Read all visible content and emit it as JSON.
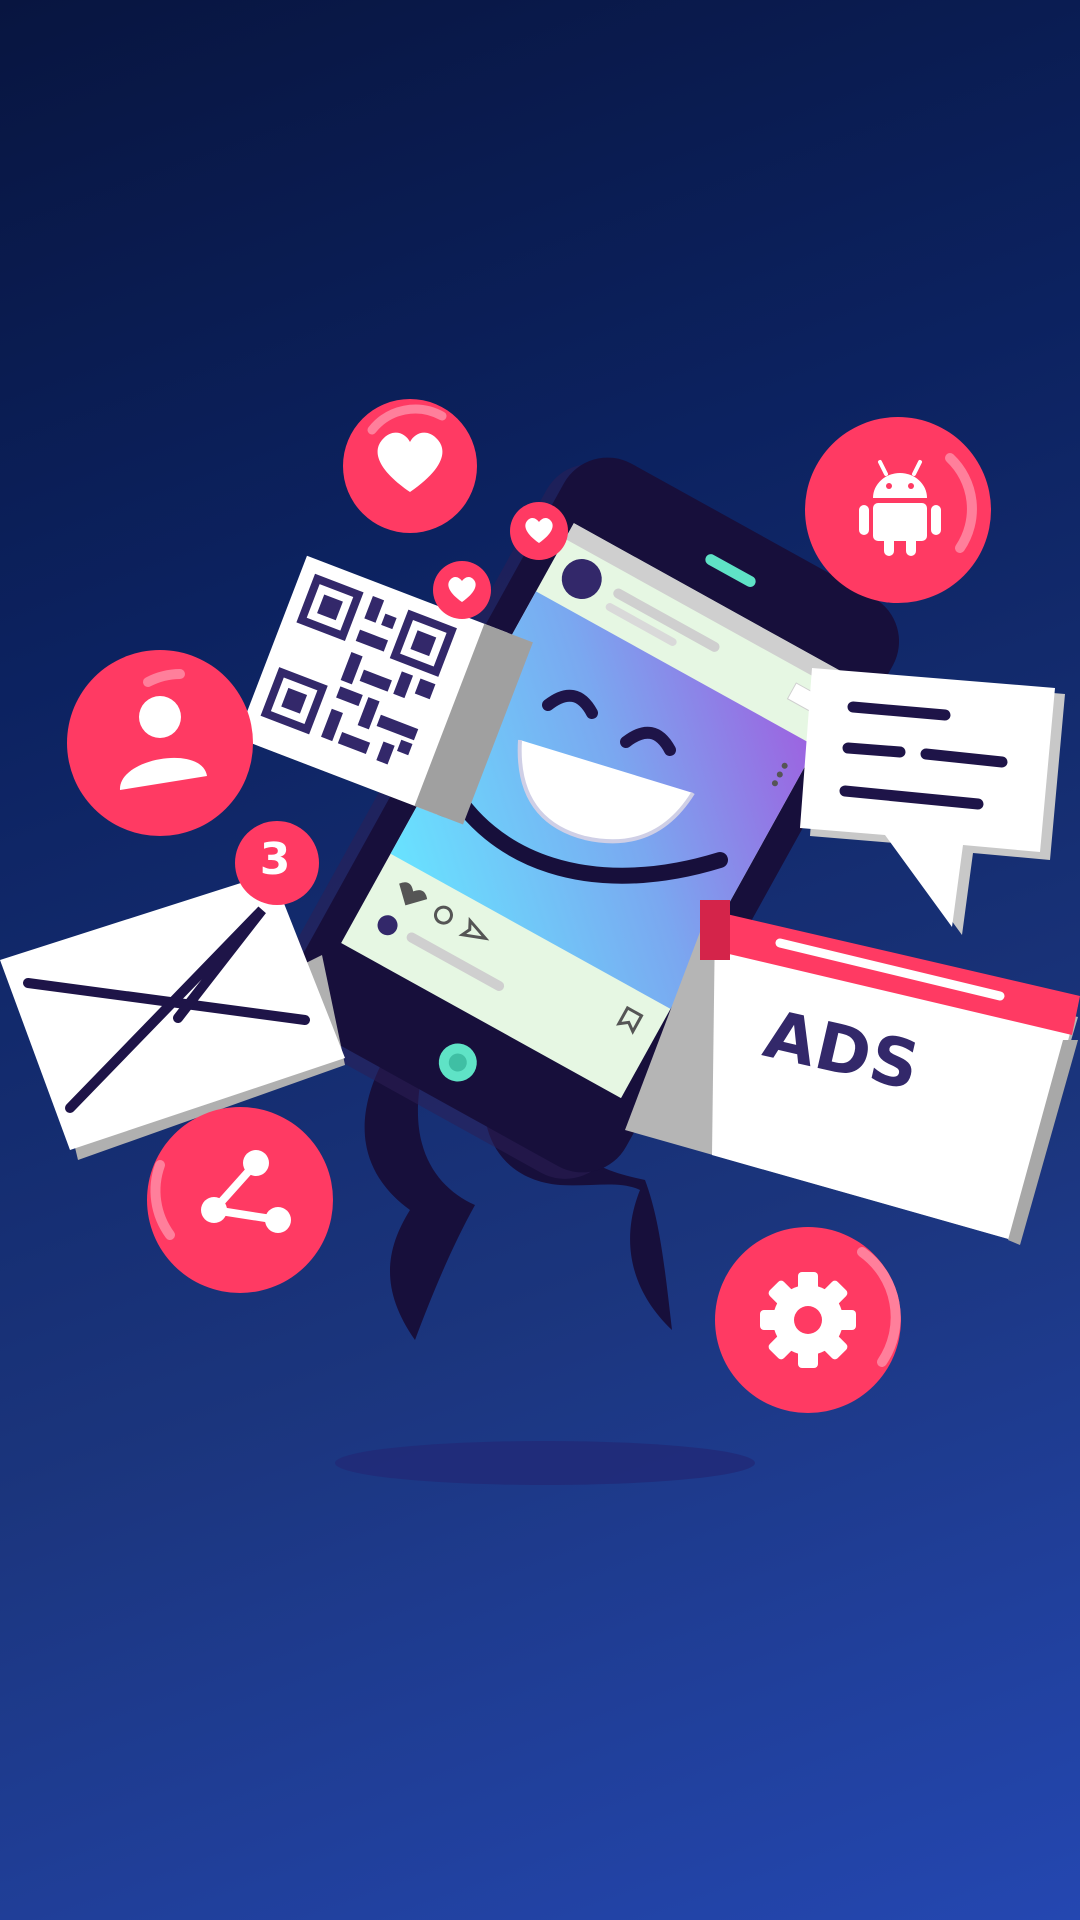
{
  "colors": {
    "background_top": "#081540",
    "background_bottom": "#2447b1",
    "accent_red": "#ff3a63",
    "phone_body": "#170f3b",
    "card_white": "#ffffff",
    "ink_purple": "#33286a",
    "teal": "#5fe3c6"
  },
  "icons": [
    "heart-icon",
    "android-icon",
    "user-icon",
    "mail-icon",
    "share-icon",
    "gear-icon",
    "qr-code-icon",
    "chat-bubble-icon"
  ],
  "ads_card": {
    "label": "ADS"
  },
  "mail": {
    "badge_count": "3"
  }
}
